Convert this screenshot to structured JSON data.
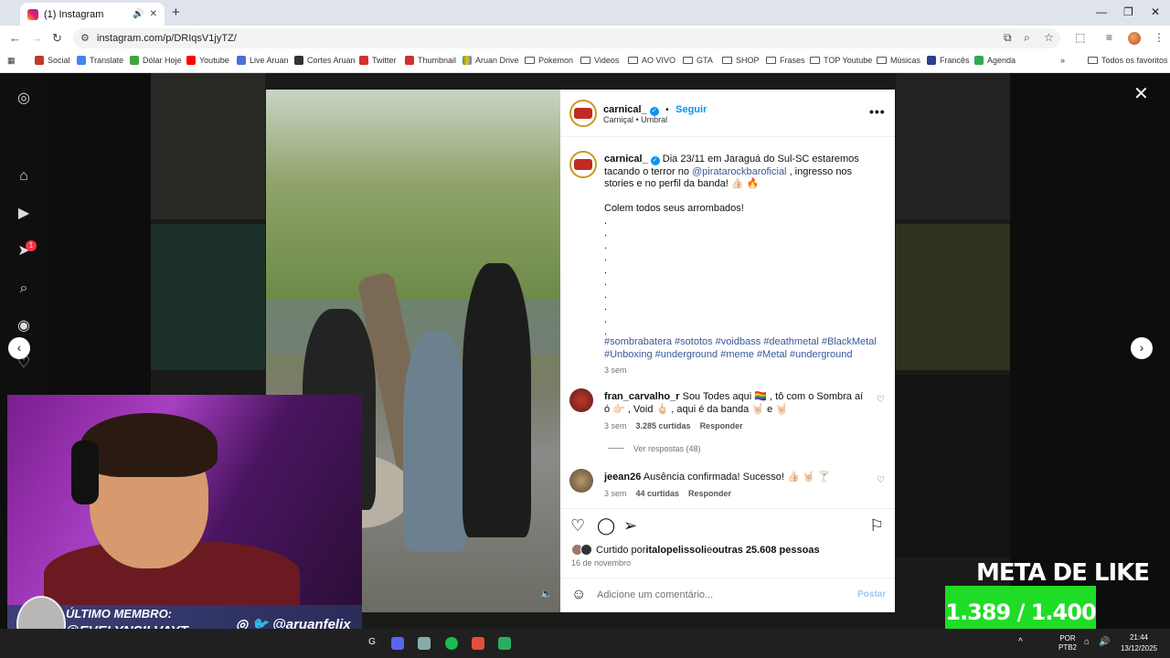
{
  "browser": {
    "tab_title": "(1) Instagram",
    "url": "instagram.com/p/DRIqsV1jyTZ/",
    "bookmarks": [
      "Social",
      "Translate",
      "Dólar Hoje",
      "Youtube",
      "Live Aruan",
      "Cortes Aruan",
      "Twitter",
      "Thumbnail",
      "Aruan Drive",
      "Pokemon",
      "Videos",
      "AO VIVO",
      "GTA",
      "SHOP",
      "Frases",
      "TOP Youtube",
      "Músicas",
      "Francês",
      "Agenda"
    ],
    "all_bookmarks": "Todos os favoritos"
  },
  "post": {
    "username": "carnical_",
    "follow_label": "Seguir",
    "subline": "Carniçal • Umbral",
    "caption_prefix": " Dia 23/11 em Jaraguá do Sul-SC estaremos tacando o terror no ",
    "caption_mention": "@piratarockbaroficial",
    "caption_suffix": " , ingresso nos stories e no perfil da banda! 👍🏻 🔥",
    "caption_line2": "Colem todos seus arrombados!",
    "hashtags": "#sombrabatera #sototos #voidbass #deathmetal #BlackMetal #Unboxing #underground #meme #Metal #underground",
    "caption_age": "3 sem",
    "comments": [
      {
        "user": "fran_carvalho_r",
        "text": " Sou Todes aqui 🏳️‍🌈 , tô com o Sombra aí ó 👉🏻 , Void 🖕🏻 , aqui é da banda 🤘🏻 e 🤘🏻",
        "age": "3 sem",
        "likes": "3.285 curtidas",
        "reply": "Responder"
      },
      {
        "user": "jeean26",
        "text": " Ausência confirmada! Sucesso! 👍🏻 🤘🏻 🍸",
        "age": "3 sem",
        "likes": "44 curtidas",
        "reply": "Responder"
      }
    ],
    "view_replies": "Ver respostas (48)",
    "liked_prefix": "Curtido por ",
    "liked_user": "italopelissoli",
    "liked_mid": " e ",
    "liked_others": "outras 25.608 pessoas",
    "date": "16 de novembro",
    "comment_placeholder": "Adicione um comentário...",
    "post_button": "Postar"
  },
  "overlay": {
    "member_title": "ÚLTIMO MEMBRO:",
    "member_name": "@EVELYNSILVAYT",
    "social_handle": "@aruanfelix",
    "goal_title": "META DE LIKE",
    "goal_value": "1.389 / 1.400"
  },
  "taskbar": {
    "lang": "POR\nPTB2",
    "time": "21:44",
    "date": "13/12/2025"
  },
  "sidebar": {
    "notification_count": "1"
  }
}
